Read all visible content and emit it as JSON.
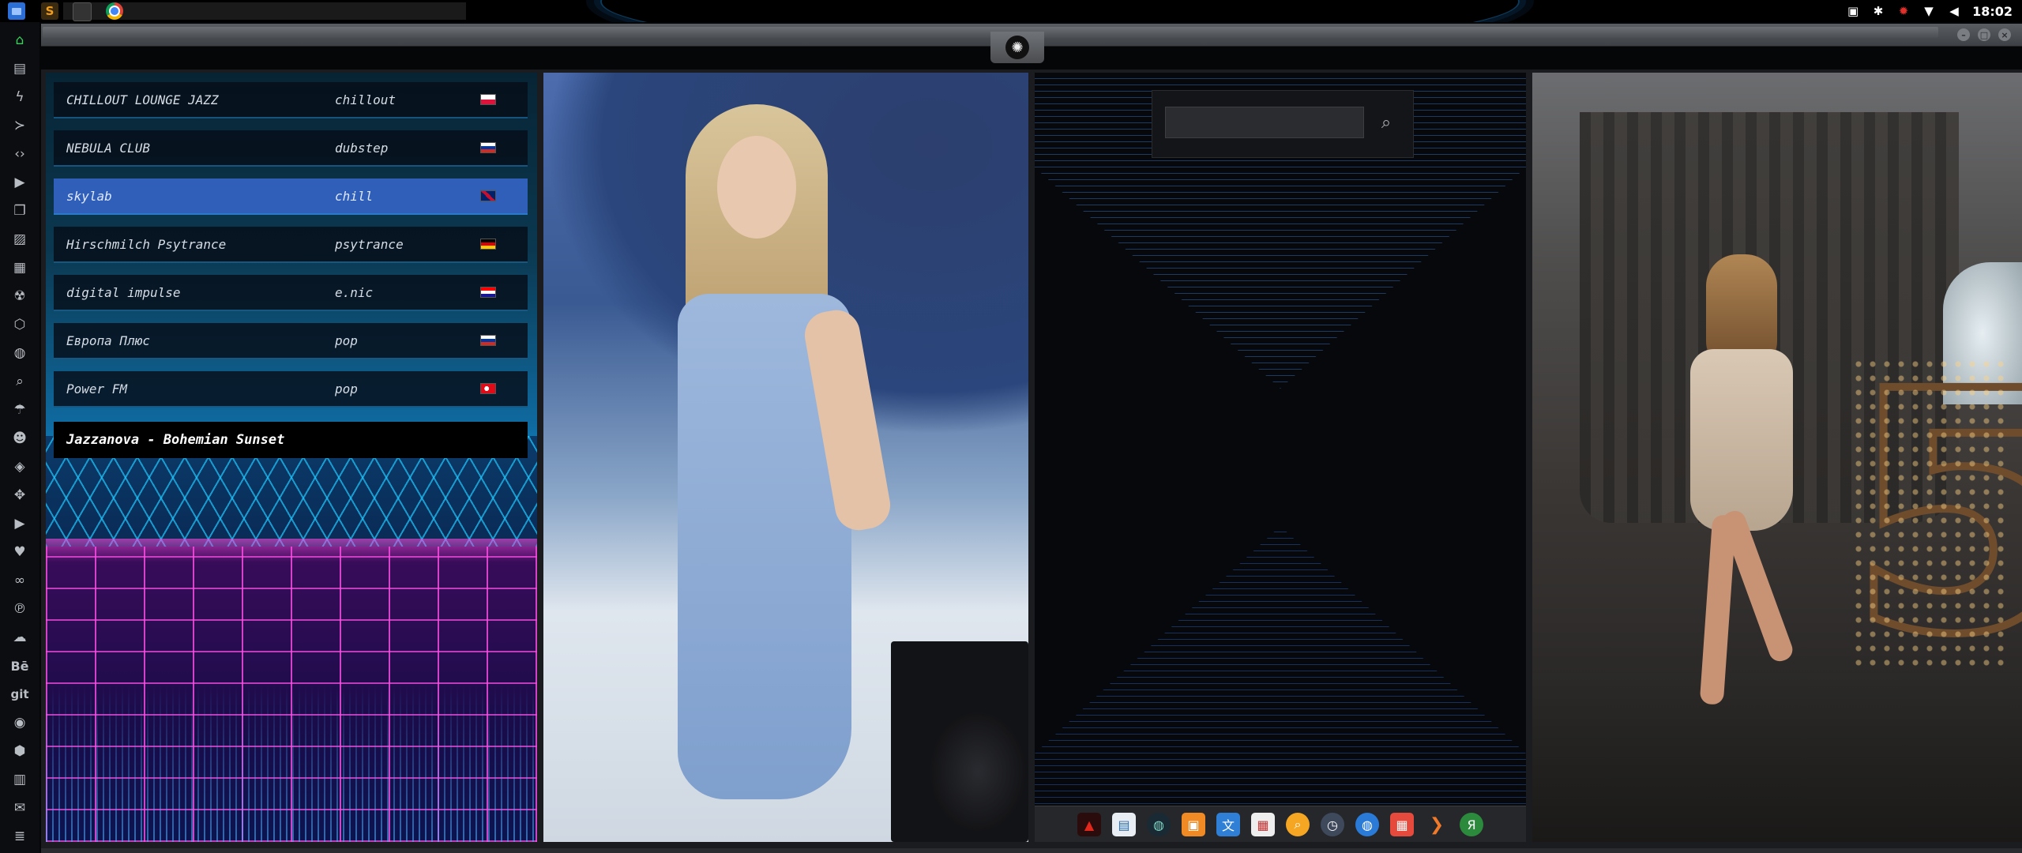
{
  "system_bar": {
    "clock": "18:02",
    "tray_icons": [
      "image-icon",
      "bluetooth-icon",
      "gear-red-icon",
      "wifi-icon",
      "volume-icon"
    ]
  },
  "taskbar_apps": [
    "files-icon",
    "sublime-text-icon",
    "terminal-icon",
    "chrome-icon"
  ],
  "sidebar_icons": [
    "home-icon",
    "document-icon",
    "lightning-icon",
    "terminal-prompt-icon",
    "code-icon",
    "play-icon",
    "pages-icon",
    "image-icon",
    "news-icon",
    "radiation-icon",
    "hexagon-icon",
    "globe-icon",
    "search-icon",
    "umbrella-icon",
    "contact-icon",
    "tag-icon",
    "expand-icon",
    "youtube-icon",
    "heart-icon",
    "infinity-icon",
    "pinterest-icon",
    "cloud-icon",
    "behance-icon",
    "git-icon",
    "github-icon",
    "cubes-icon",
    "map-icon",
    "mail-icon",
    "server-icon",
    "list-icon"
  ],
  "sidebar_text": {
    "behance": "Bē",
    "git": "git"
  },
  "radio": {
    "stations": [
      {
        "name": "CHILLOUT LOUNGE JAZZ",
        "genre": "chillout",
        "flag": "poland"
      },
      {
        "name": "NEBULA CLUB",
        "genre": "dubstep",
        "flag": "russia"
      },
      {
        "name": "skylab",
        "genre": "chill",
        "flag": "uk",
        "selected": true
      },
      {
        "name": "Hirschmilch Psytrance",
        "genre": "psytrance",
        "flag": "germany"
      },
      {
        "name": "digital impulse",
        "genre": "e.nic",
        "flag": "croatia"
      },
      {
        "name": "Европа Плюс",
        "genre": "pop",
        "flag": "russia"
      },
      {
        "name": "Power FM",
        "genre": "pop",
        "flag": "turkey"
      }
    ],
    "now_playing": "Jazzanova - Bohemian Sunset"
  },
  "search": {
    "placeholder": ""
  },
  "dock_icons": [
    "acrobat-icon",
    "spreadsheet-icon",
    "globe-dark-icon",
    "photos-icon",
    "translate-icon",
    "news-icon",
    "search-orange-icon",
    "clock-icon",
    "web-globe-icon",
    "calendar-icon",
    "arrow-icon",
    "yandex-icon"
  ],
  "dock_glyphs": {
    "yandex": "Я"
  },
  "colors": {
    "accent": "#37d15c",
    "selected_row": "#2f5fb8"
  }
}
